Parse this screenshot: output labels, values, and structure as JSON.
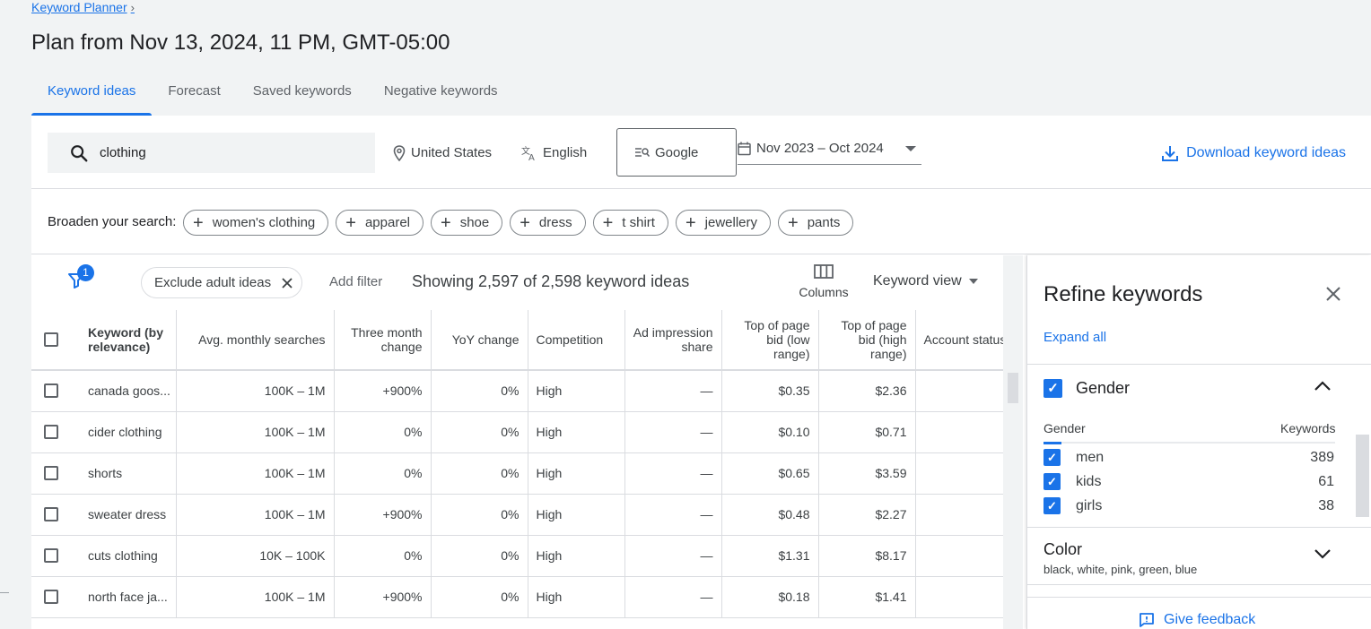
{
  "breadcrumb": {
    "label": "Keyword Planner",
    "chevron": "›"
  },
  "page_title": "Plan from Nov 13, 2024, 11 PM, GMT-05:00",
  "tabs": [
    {
      "label": "Keyword ideas",
      "active": true
    },
    {
      "label": "Forecast",
      "active": false
    },
    {
      "label": "Saved keywords",
      "active": false
    },
    {
      "label": "Negative keywords",
      "active": false
    }
  ],
  "search": {
    "value": "clothing",
    "icon": "search-icon"
  },
  "location": {
    "label": "United States",
    "icon": "location-pin-icon"
  },
  "language": {
    "label": "English",
    "icon": "translate-icon"
  },
  "network": {
    "label": "Google",
    "icon": "search-network-icon"
  },
  "date_range": {
    "label": "Nov 2023 – Oct 2024",
    "icon": "calendar-icon"
  },
  "download": {
    "label": "Download keyword ideas",
    "icon": "download-icon"
  },
  "broaden": {
    "label": "Broaden your search:",
    "chips": [
      "women's clothing",
      "apparel",
      "shoe",
      "dress",
      "t shirt",
      "jewellery",
      "pants"
    ]
  },
  "filters": {
    "badge_count": "1",
    "exclude_chip": "Exclude adult ideas",
    "add_filter": "Add filter",
    "showing": "Showing 2,597 of 2,598 keyword ideas",
    "columns_label": "Columns",
    "view_label": "Keyword view"
  },
  "table": {
    "headers": {
      "keyword": "Keyword (by relevance)",
      "avg": "Avg. monthly searches",
      "three_month": "Three month change",
      "yoy": "YoY change",
      "competition": "Competition",
      "impression": "Ad impression share",
      "bid_low": "Top of page bid (low range)",
      "bid_high": "Top of page bid (high range)",
      "account": "Account status"
    },
    "rows": [
      {
        "keyword": "canada goos...",
        "avg": "100K – 1M",
        "three_month": "+900%",
        "yoy": "0%",
        "competition": "High",
        "impression": "—",
        "bid_low": "$0.35",
        "bid_high": "$2.36",
        "account": ""
      },
      {
        "keyword": "cider clothing",
        "avg": "100K – 1M",
        "three_month": "0%",
        "yoy": "0%",
        "competition": "High",
        "impression": "—",
        "bid_low": "$0.10",
        "bid_high": "$0.71",
        "account": ""
      },
      {
        "keyword": "shorts",
        "avg": "100K – 1M",
        "three_month": "0%",
        "yoy": "0%",
        "competition": "High",
        "impression": "—",
        "bid_low": "$0.65",
        "bid_high": "$3.59",
        "account": ""
      },
      {
        "keyword": "sweater dress",
        "avg": "100K – 1M",
        "three_month": "+900%",
        "yoy": "0%",
        "competition": "High",
        "impression": "—",
        "bid_low": "$0.48",
        "bid_high": "$2.27",
        "account": ""
      },
      {
        "keyword": "cuts clothing",
        "avg": "10K – 100K",
        "three_month": "0%",
        "yoy": "0%",
        "competition": "High",
        "impression": "—",
        "bid_low": "$1.31",
        "bid_high": "$8.17",
        "account": ""
      },
      {
        "keyword": "north face ja...",
        "avg": "100K – 1M",
        "three_month": "+900%",
        "yoy": "0%",
        "competition": "High",
        "impression": "—",
        "bid_low": "$0.18",
        "bid_high": "$1.41",
        "account": ""
      }
    ]
  },
  "refine": {
    "title": "Refine keywords",
    "expand_all": "Expand all",
    "gender": {
      "title": "Gender",
      "col_left": "Gender",
      "col_right": "Keywords",
      "items": [
        {
          "name": "men",
          "count": "389"
        },
        {
          "name": "kids",
          "count": "61"
        },
        {
          "name": "girls",
          "count": "38"
        }
      ]
    },
    "color": {
      "title": "Color",
      "subtitle": "black, white, pink, green, blue"
    },
    "feedback": "Give feedback"
  },
  "colors": {
    "accent": "#1a73e8",
    "text": "#202124",
    "muted": "#5f6368",
    "border": "#dadce0"
  }
}
